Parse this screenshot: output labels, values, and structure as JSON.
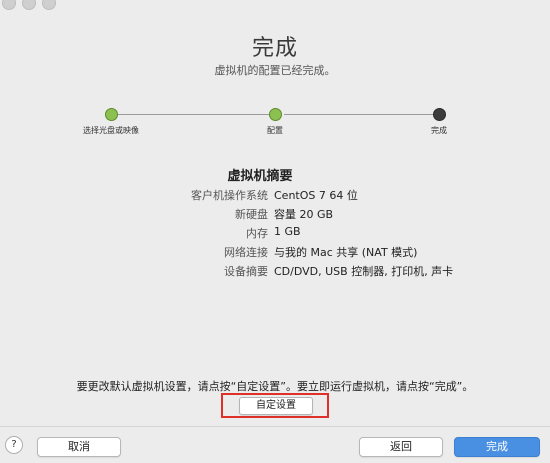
{
  "header": {
    "title": "完成",
    "subtitle": "虚拟机的配置已经完成。"
  },
  "steps": [
    {
      "label": "选择光盘或映像",
      "state": "complete"
    },
    {
      "label": "配置",
      "state": "complete"
    },
    {
      "label": "完成",
      "state": "current"
    }
  ],
  "summary": {
    "heading": "虚拟机摘要",
    "rows": [
      {
        "key": "客户机操作系统",
        "value": "CentOS 7 64 位"
      },
      {
        "key": "新硬盘",
        "value": "容量 20 GB"
      },
      {
        "key": "内存",
        "value": "1 GB"
      },
      {
        "key": "网络连接",
        "value": "与我的 Mac 共享 (NAT 模式)"
      },
      {
        "key": "设备摘要",
        "value": "CD/DVD, USB 控制器, 打印机, 声卡"
      }
    ]
  },
  "hint": "要更改默认虚拟机设置，请点按“自定设置”。要立即运行虚拟机，请点按“完成”。",
  "buttons": {
    "customize": "自定设置",
    "help": "?",
    "cancel": "取消",
    "back": "返回",
    "finish": "完成"
  },
  "colors": {
    "step_complete": "#8cc152",
    "step_current": "#3c3c3c",
    "highlight_frame": "#e0302a",
    "primary_button": "#4a90e2"
  }
}
